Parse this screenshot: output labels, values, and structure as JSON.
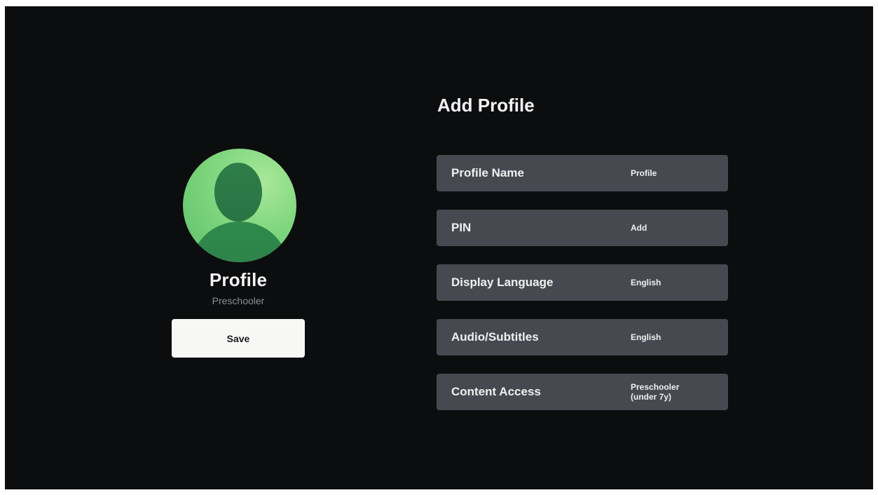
{
  "profile": {
    "name": "Profile",
    "type": "Preschooler",
    "avatar": "person-avatar-icon",
    "save_label": "Save"
  },
  "form": {
    "title": "Add Profile",
    "rows": [
      {
        "label": "Profile Name",
        "value": "Profile"
      },
      {
        "label": "PIN",
        "value": "Add"
      },
      {
        "label": "Display Language",
        "value": "English"
      },
      {
        "label": "Audio/Subtitles",
        "value": "English"
      },
      {
        "label": "Content Access",
        "value": "Preschooler\n(under 7y)"
      }
    ]
  },
  "colors": {
    "background": "#0c0d0e",
    "row_background": "#464950",
    "avatar_light": "#7fd67e",
    "avatar_dark": "#2d7c46",
    "button_background": "#f7f7f6"
  }
}
